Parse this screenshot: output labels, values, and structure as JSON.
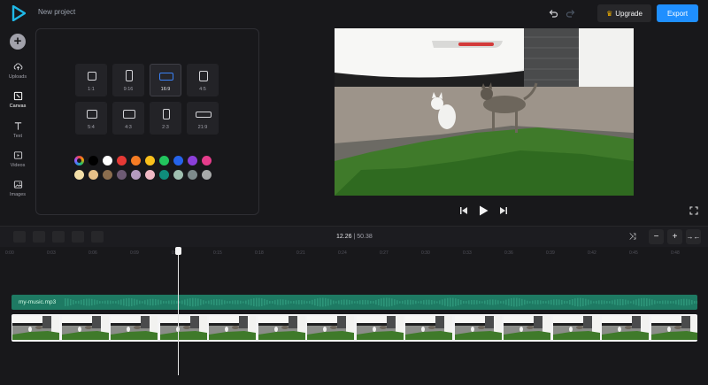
{
  "app": {
    "project_title": "New project",
    "brand_color": "#1f8fff"
  },
  "toolbar": {
    "upgrade_label": "Upgrade",
    "export_label": "Export"
  },
  "sidebar": {
    "items": [
      {
        "label": "Uploads",
        "icon": "upload-cloud-icon"
      },
      {
        "label": "Canvas",
        "icon": "canvas-icon"
      },
      {
        "label": "Text",
        "icon": "text-icon"
      },
      {
        "label": "Videos",
        "icon": "video-icon"
      },
      {
        "label": "Images",
        "icon": "image-icon"
      }
    ]
  },
  "canvas": {
    "ratios": [
      "1:1",
      "9:16",
      "16:9",
      "4:5",
      "5:4",
      "4:3",
      "2:3",
      "21:9"
    ],
    "selected_ratio": "16:9",
    "colors": [
      "#000000",
      "#ffffff",
      "#e53935",
      "#f57c24",
      "#f9c01c",
      "#22c55e",
      "#2563eb",
      "#8b3fd9",
      "#e63d8c",
      "#f3dfa8",
      "#e7c088",
      "#8b6d4e",
      "#6d5a74",
      "#b49ac0",
      "#f0b8c4",
      "#0f8c7c",
      "#9fbfb0",
      "#7d8b8c",
      "#a8aaaa"
    ]
  },
  "timeline": {
    "current_time": "12.26",
    "separator": " | ",
    "total_time": "50.38",
    "ruler_ticks": [
      "0:00",
      "0:03",
      "0:06",
      "0:09",
      "0:12",
      "0:15",
      "0:18",
      "0:21",
      "0:24",
      "0:27",
      "0:30",
      "0:33",
      "0:36",
      "0:39",
      "0:42",
      "0:45",
      "0:48"
    ],
    "audio_clip": "my-music.mp3",
    "audio_color": "#1e7a63"
  }
}
